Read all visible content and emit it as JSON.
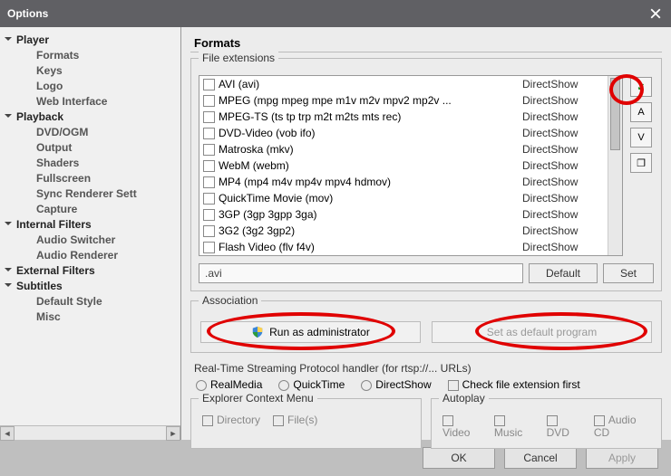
{
  "titlebar": {
    "title": "Options"
  },
  "sidebar": {
    "categories": [
      {
        "label": "Player",
        "children": [
          "Formats",
          "Keys",
          "Logo",
          "Web Interface"
        ]
      },
      {
        "label": "Playback",
        "children": [
          "DVD/OGM",
          "Output",
          "Shaders",
          "Fullscreen",
          "Sync Renderer Sett",
          "Capture"
        ]
      },
      {
        "label": "Internal Filters",
        "children": [
          "Audio Switcher",
          "Audio Renderer"
        ]
      },
      {
        "label": "External Filters",
        "children": []
      },
      {
        "label": "Subtitles",
        "children": [
          "Default Style",
          "Misc"
        ]
      }
    ]
  },
  "content": {
    "heading": "Formats",
    "file_ext_legend": "File extensions",
    "formats": [
      {
        "label": "AVI (avi)",
        "filter": "DirectShow"
      },
      {
        "label": "MPEG (mpg mpeg mpe m1v m2v mpv2 mp2v ...",
        "filter": "DirectShow"
      },
      {
        "label": "MPEG-TS (ts tp trp m2t m2ts mts rec)",
        "filter": "DirectShow"
      },
      {
        "label": "DVD-Video (vob ifo)",
        "filter": "DirectShow"
      },
      {
        "label": "Matroska (mkv)",
        "filter": "DirectShow"
      },
      {
        "label": "WebM (webm)",
        "filter": "DirectShow"
      },
      {
        "label": "MP4 (mp4 m4v mp4v mpv4 hdmov)",
        "filter": "DirectShow"
      },
      {
        "label": "QuickTime Movie (mov)",
        "filter": "DirectShow"
      },
      {
        "label": "3GP (3gp 3gpp 3ga)",
        "filter": "DirectShow"
      },
      {
        "label": "3G2 (3g2 3gp2)",
        "filter": "DirectShow"
      },
      {
        "label": "Flash Video (flv f4v)",
        "filter": "DirectShow"
      }
    ],
    "side_btns": [
      "✓",
      "A",
      "V",
      "❐"
    ],
    "ext_value": ".avi",
    "default_btn": "Default",
    "set_btn": "Set",
    "association_legend": "Association",
    "run_admin": "Run as administrator",
    "set_default_prog": "Set as default program",
    "rtsp_legend": "Real-Time Streaming Protocol handler (for rtsp://... URLs)",
    "rtsp_opts": [
      "RealMedia",
      "QuickTime",
      "DirectShow"
    ],
    "rtsp_check": "Check file extension first",
    "explorer_legend": "Explorer Context Menu",
    "explorer_opts": [
      "Directory",
      "File(s)"
    ],
    "autoplay_legend": "Autoplay",
    "autoplay_opts": [
      "Video",
      "Music",
      "DVD",
      "Audio CD"
    ]
  },
  "buttons": {
    "ok": "OK",
    "cancel": "Cancel",
    "apply": "Apply"
  }
}
